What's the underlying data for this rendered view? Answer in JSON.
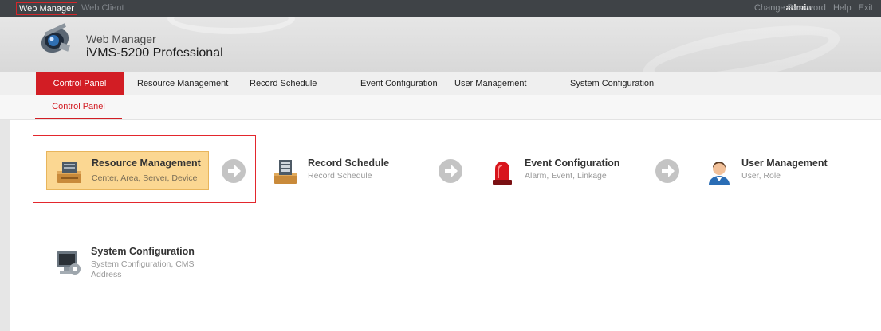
{
  "top": {
    "tabs": [
      "Web Manager",
      "Web Client"
    ],
    "user": "admin",
    "links": [
      "Change Password",
      "Help",
      "Exit"
    ]
  },
  "header": {
    "subtitle": "Web Manager",
    "title": "iVMS-5200 Professional",
    "logo_icon": "camera-lens-logo"
  },
  "nav": {
    "items": [
      "Control Panel",
      "Resource Management",
      "Record Schedule",
      "Event Configuration",
      "User Management",
      "System Configuration"
    ],
    "active": "Control Panel"
  },
  "subnav": {
    "active_tab": "Control Panel"
  },
  "tiles": [
    {
      "title": "Resource Management",
      "desc": "Center, Area, Server, Device",
      "icon": "server-device-icon"
    },
    {
      "title": "Record Schedule",
      "desc": "Record Schedule",
      "icon": "schedule-tray-icon"
    },
    {
      "title": "Event Configuration",
      "desc": "Alarm, Event, Linkage",
      "icon": "alarm-siren-icon"
    },
    {
      "title": "User Management",
      "desc": "User, Role",
      "icon": "user-icon"
    },
    {
      "title": "System Configuration",
      "desc": "System Configuration, CMS Address",
      "icon": "monitor-gear-icon"
    }
  ],
  "colors": {
    "accent": "#d21d24",
    "highlight": "#fbd792",
    "topbar": "#3f4347"
  }
}
